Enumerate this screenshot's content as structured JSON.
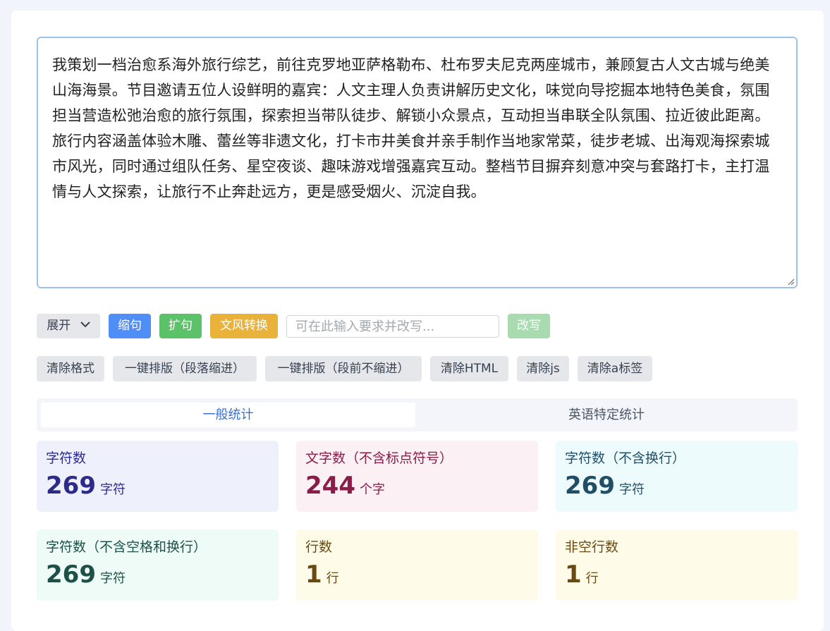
{
  "editor": {
    "text": "我策划一档治愈系海外旅行综艺，前往克罗地亚萨格勒布、杜布罗夫尼克两座城市，兼顾复古人文古城与绝美山海海景。节目邀请五位人设鲜明的嘉宾：人文主理人负责讲解历史文化，味觉向导挖掘本地特色美食，氛围担当营造松弛治愈的旅行氛围，探索担当带队徒步、解锁小众景点，互动担当串联全队氛围、拉近彼此距离。旅行内容涵盖体验木雕、蕾丝等非遗文化，打卡市井美食并亲手制作当地家常菜，徒步老城、出海观海探索城市风光，同时通过组队任务、星空夜谈、趣味游戏增强嘉宾互动。整档节目摒弃刻意冲突与套路打卡，主打温情与人文探索，让旅行不止奔赴远方，更是感受烟火、沉淀自我。"
  },
  "toolbar": {
    "expand_label": "展开",
    "shrink_label": "缩句",
    "extend_label": "扩句",
    "style_label": "文风转换",
    "request_placeholder": "可在此输入要求并改写...",
    "rewrite_label": "改写"
  },
  "format_tools": {
    "clear_format": "清除格式",
    "layout_indent": "一键排版（段落缩进）",
    "layout_no_indent": "一键排版（段前不缩进）",
    "clear_html": "清除HTML",
    "clear_js": "清除js",
    "clear_a": "清除a标签"
  },
  "tabs": {
    "general": "一般统计",
    "english": "英语特定统计"
  },
  "stats": [
    {
      "label": "字符数",
      "value": "269",
      "unit": "字符",
      "bg": "#eef0fb",
      "fg": "#2e2a8a"
    },
    {
      "label": "文字数（不含标点符号）",
      "value": "244",
      "unit": "个字",
      "bg": "#fbf0f4",
      "fg": "#8a1c48"
    },
    {
      "label": "字符数（不含换行）",
      "value": "269",
      "unit": "字符",
      "bg": "#eefbfd",
      "fg": "#1f4e66"
    },
    {
      "label": "字符数（不含空格和换行）",
      "value": "269",
      "unit": "字符",
      "bg": "#eefbf6",
      "fg": "#1d5049"
    },
    {
      "label": "行数",
      "value": "1",
      "unit": "行",
      "bg": "#fefbe9",
      "fg": "#6b4a12"
    },
    {
      "label": "非空行数",
      "value": "1",
      "unit": "行",
      "bg": "#fefbe9",
      "fg": "#6b4a12"
    }
  ]
}
